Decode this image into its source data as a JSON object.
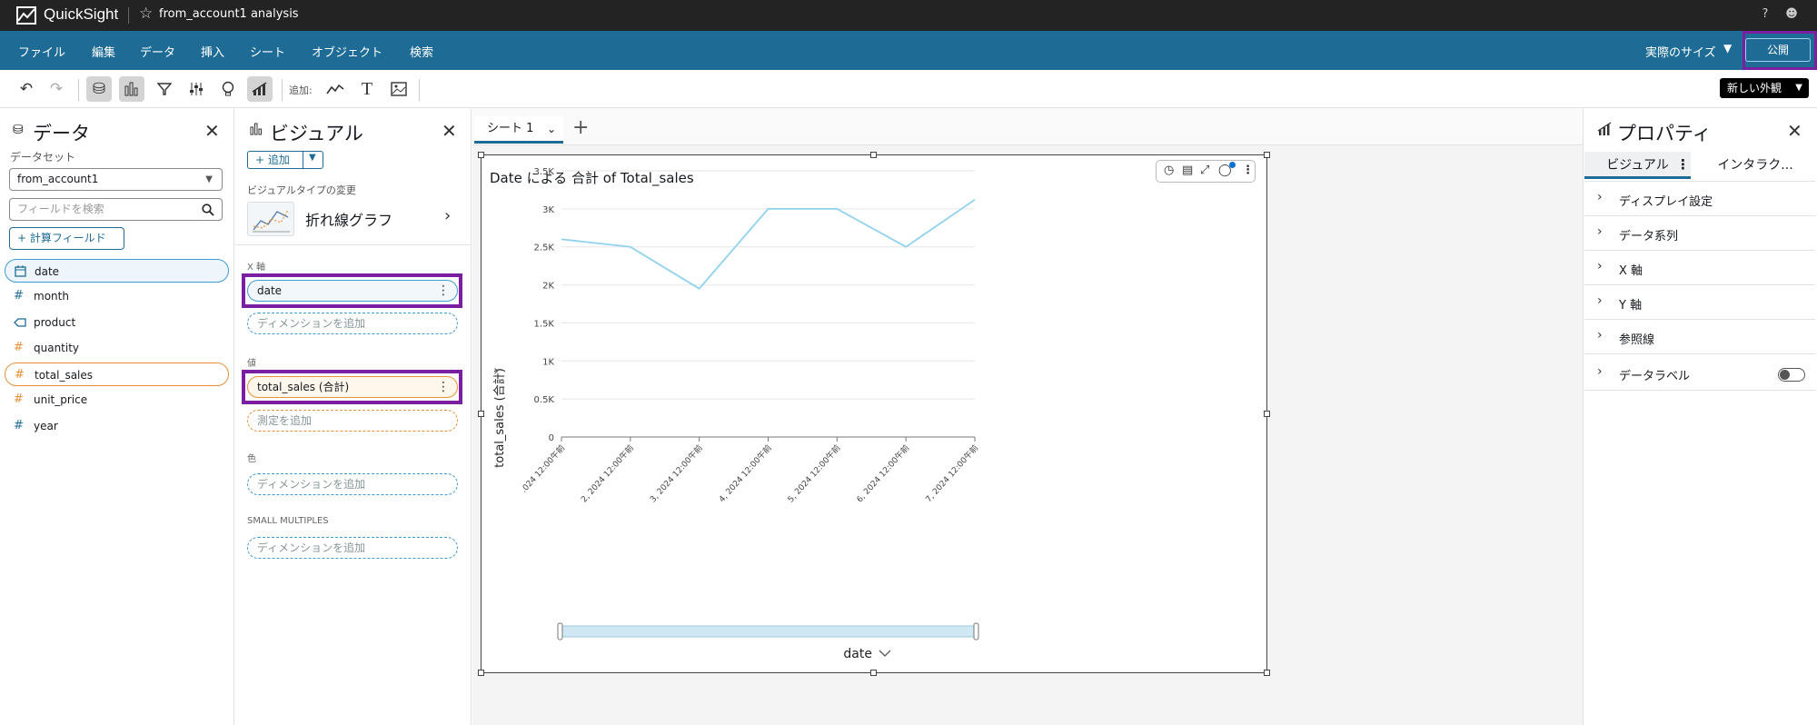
{
  "app": {
    "brand": "QuickSight",
    "document_title": "from_account1 analysis"
  },
  "menu": {
    "items": [
      "ファイル",
      "編集",
      "データ",
      "挿入",
      "シート",
      "オブジェクト",
      "検索"
    ],
    "scale": "実際のサイズ",
    "publish": "公開"
  },
  "toolbar": {
    "add_label": "追加:",
    "new_look": "新しい外観"
  },
  "data_panel": {
    "title": "データ",
    "dataset_label": "データセット",
    "dataset": "from_account1",
    "search_placeholder": "フィールドを検索",
    "calc_field": "+ 計算フィールド",
    "fields": [
      {
        "name": "date",
        "icon": "calendar-icon",
        "selected": "blue"
      },
      {
        "name": "month",
        "icon": "hash-icon",
        "selected": ""
      },
      {
        "name": "product",
        "icon": "tag-icon",
        "selected": ""
      },
      {
        "name": "quantity",
        "icon": "hash-icon",
        "selected": ""
      },
      {
        "name": "total_sales",
        "icon": "hash-icon",
        "selected": "orange"
      },
      {
        "name": "unit_price",
        "icon": "hash-icon",
        "selected": ""
      },
      {
        "name": "year",
        "icon": "hash-icon",
        "selected": ""
      }
    ]
  },
  "visual_panel": {
    "title": "ビジュアル",
    "add": "+ 追加",
    "change_type_label": "ビジュアルタイプの変更",
    "type_name": "折れ線グラフ",
    "x_axis_label": "X 軸",
    "x_field": "date",
    "add_dimension": "ディメンションを追加",
    "value_label": "値",
    "value_field": "total_sales (合計)",
    "add_measure": "測定を追加",
    "color_label": "色",
    "color_add": "ディメンションを追加",
    "small_multiples_label": "SMALL MULTIPLES",
    "small_multiples_add": "ディメンションを追加"
  },
  "sheet": {
    "tab": "シート 1"
  },
  "properties": {
    "title": "プロパティ",
    "tabs": [
      "ビジュアル",
      "インタラク..."
    ],
    "sections": [
      "ディスプレイ設定",
      "データ系列",
      "X 軸",
      "Y 軸",
      "参照線",
      "データラベル"
    ]
  },
  "chart_data": {
    "type": "line",
    "title": "Date による 合計 of Total_sales",
    "xlabel": "date",
    "ylabel": "total_sales (合計)",
    "ylim": [
      0,
      3500
    ],
    "yticks": [
      "0",
      "0.5K",
      "1K",
      "1.5K",
      "2K",
      "2.5K",
      "3K",
      "3.5K"
    ],
    "categories": [
      ".024 12:00午前",
      "2, 2024 12:00午前",
      "3, 2024 12:00午前",
      "4, 2024 12:00午前",
      "5, 2024 12:00午前",
      "6, 2024 12:00午前",
      "7, 2024 12:00午前"
    ],
    "series": [
      {
        "values": [
          2600,
          2500,
          1950,
          3000,
          3000,
          2500,
          3120
        ]
      }
    ],
    "line_color": "#8fd2ee"
  }
}
